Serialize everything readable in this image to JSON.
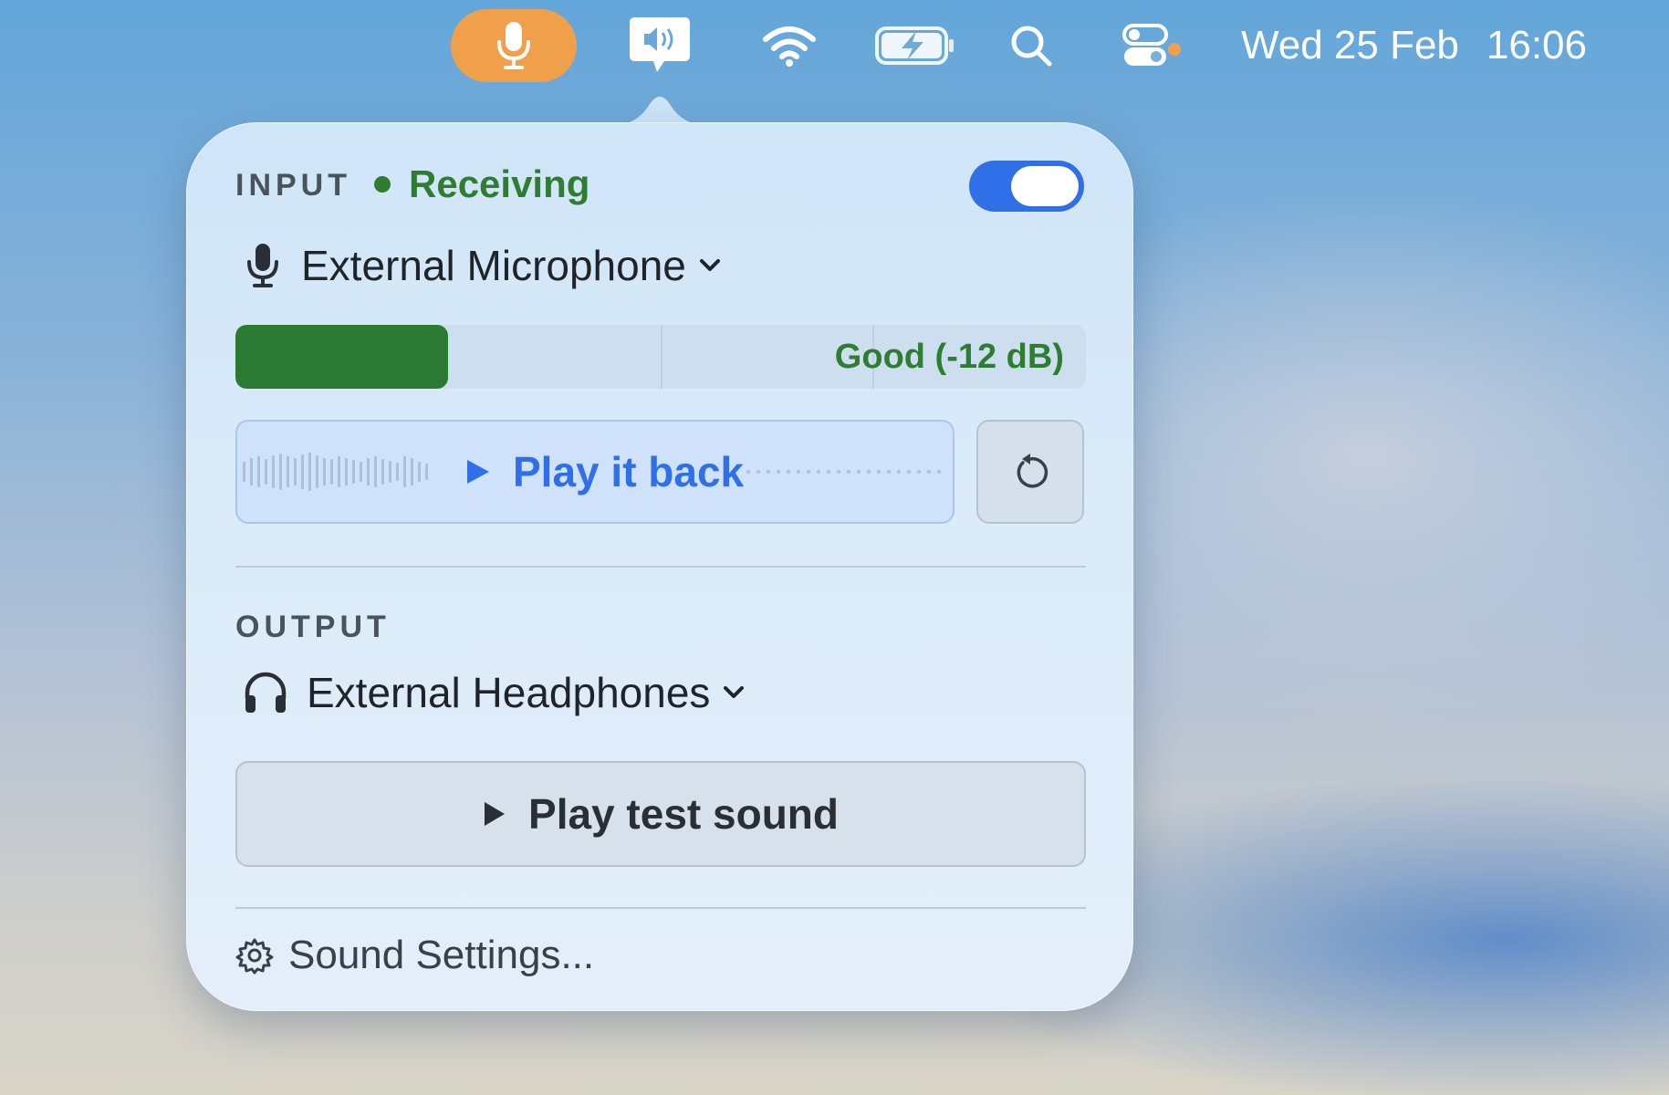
{
  "menubar": {
    "icons": [
      "microphone-icon",
      "speaker-bubble-icon",
      "wifi-icon",
      "battery-charging-icon",
      "search-icon",
      "control-center-icon"
    ],
    "accent_color": "#f0a04b",
    "date": "Wed 25 Feb",
    "time": "16:06"
  },
  "popover": {
    "input": {
      "section_label": "INPUT",
      "status": "Receiving",
      "status_color": "#2f7d32",
      "toggle_on": true,
      "device": "External Microphone",
      "level_fraction": 0.25,
      "level_text": "Good (-12 dB)",
      "playback_label": "Play it back",
      "reset_icon": "reset-icon"
    },
    "output": {
      "section_label": "OUTPUT",
      "device": "External Headphones",
      "test_button": "Play test sound"
    },
    "settings_link": "Sound Settings..."
  },
  "colors": {
    "accent_blue": "#2f6fe8",
    "good_green": "#2b7a33"
  }
}
